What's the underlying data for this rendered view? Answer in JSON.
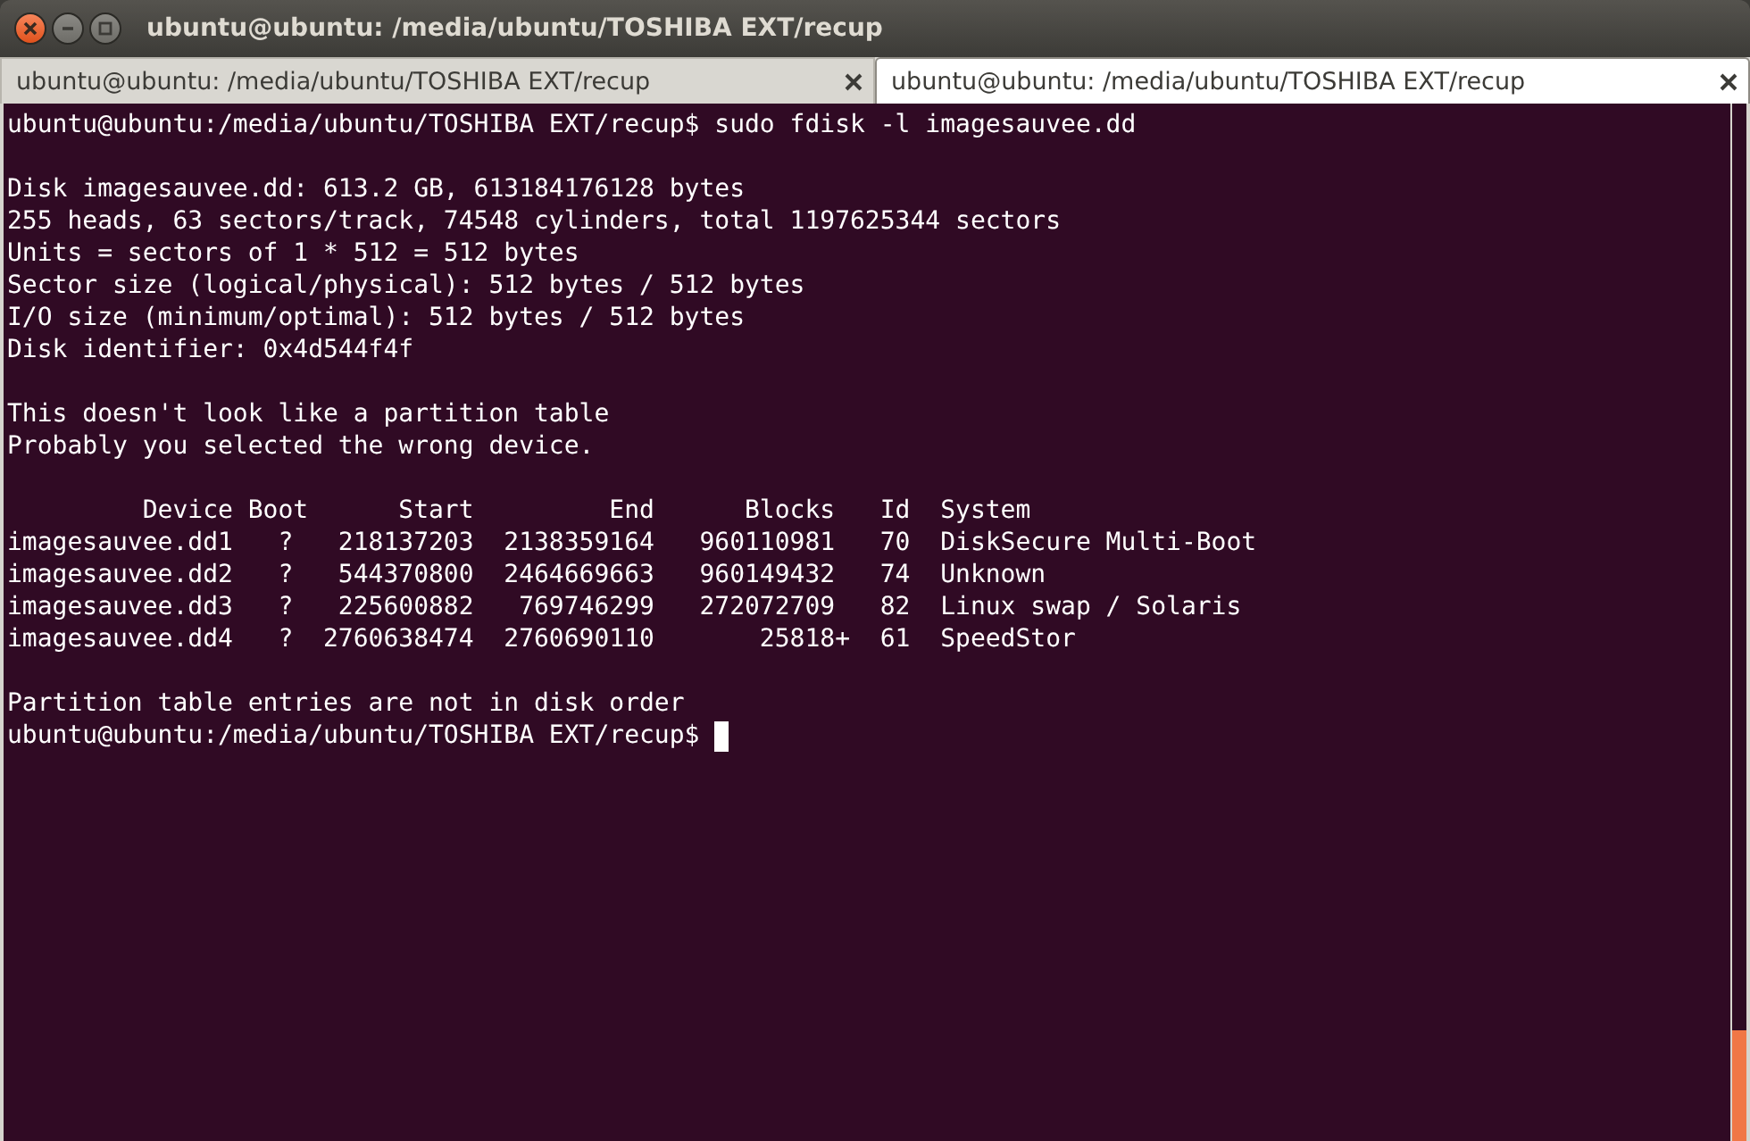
{
  "window": {
    "title": "ubuntu@ubuntu: /media/ubuntu/TOSHIBA EXT/recup"
  },
  "tabs": [
    {
      "label": "ubuntu@ubuntu: /media/ubuntu/TOSHIBA EXT/recup",
      "selected": false
    },
    {
      "label": "ubuntu@ubuntu: /media/ubuntu/TOSHIBA EXT/recup",
      "selected": true
    }
  ],
  "terminal": {
    "blocks": [
      {
        "lines": [
          "ubuntu@ubuntu:/media/ubuntu/TOSHIBA EXT/recup$ sudo fdisk -l imagesauvee.dd"
        ]
      },
      {
        "lines": [
          "Disk imagesauvee.dd: 613.2 GB, 613184176128 bytes",
          "255 heads, 63 sectors/track, 74548 cylinders, total 1197625344 sectors",
          "Units = sectors of 1 * 512 = 512 bytes",
          "Sector size (logical/physical): 512 bytes / 512 bytes",
          "I/O size (minimum/optimal): 512 bytes / 512 bytes",
          "Disk identifier: 0x4d544f4f"
        ]
      },
      {
        "lines": [
          "This doesn't look like a partition table",
          "Probably you selected the wrong device."
        ]
      },
      {
        "lines": [
          "         Device Boot      Start         End      Blocks   Id  System",
          "imagesauvee.dd1   ?   218137203  2138359164   960110981   70  DiskSecure Multi-Boot",
          "imagesauvee.dd2   ?   544370800  2464669663   960149432   74  Unknown",
          "imagesauvee.dd3   ?   225600882   769746299   272072709   82  Linux swap / Solaris",
          "imagesauvee.dd4   ?  2760638474  2760690110       25818+  61  SpeedStor"
        ]
      },
      {
        "lines": [
          "Partition table entries are not in disk order"
        ]
      }
    ],
    "prompt": "ubuntu@ubuntu:/media/ubuntu/TOSHIBA EXT/recup$"
  }
}
